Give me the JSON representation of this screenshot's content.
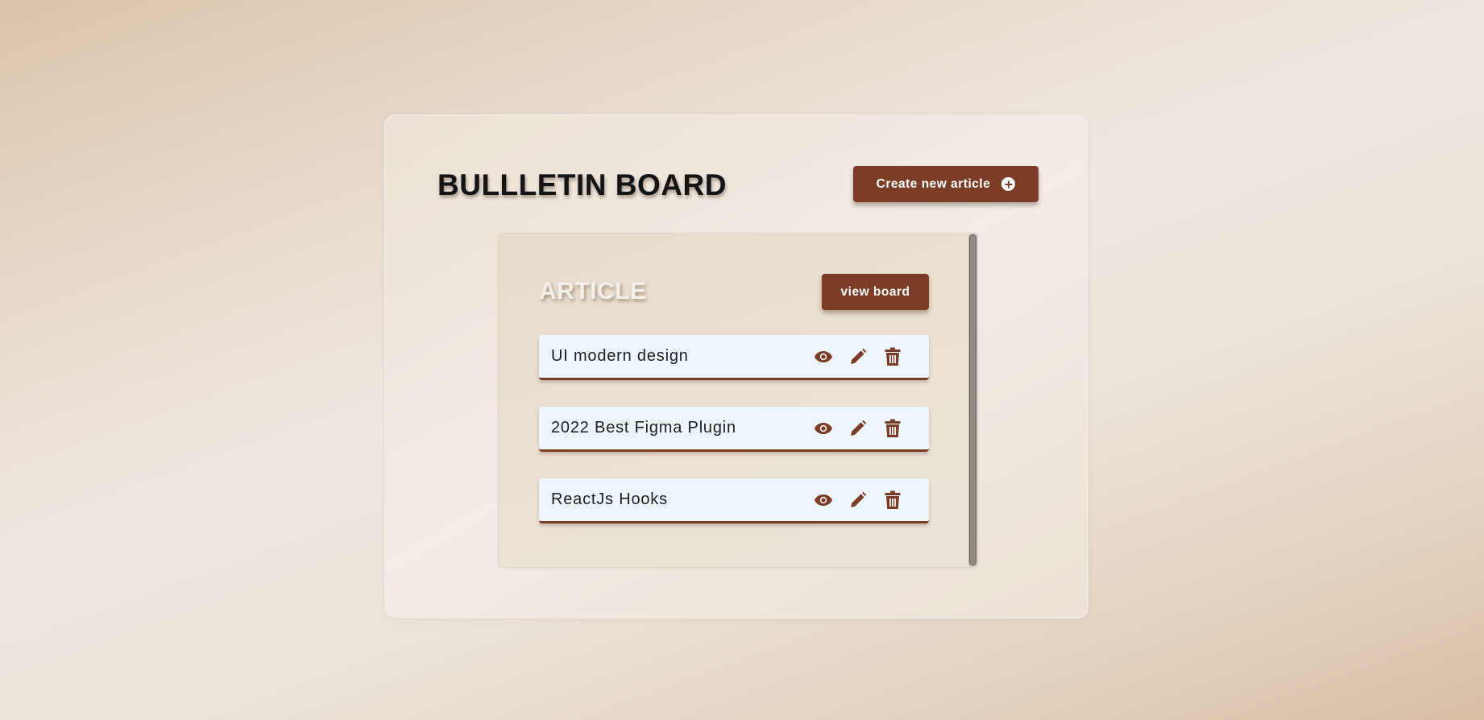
{
  "board": {
    "title": "BULLLETIN BOARD",
    "create_button_label": "Create new article",
    "create_button_icon": "plus-circle-icon"
  },
  "article_panel": {
    "title": "ARTICLE",
    "view_button_label": "view board",
    "items": [
      {
        "title": "UI modern design",
        "actions": [
          "eye-icon",
          "pencil-icon",
          "trash-icon"
        ]
      },
      {
        "title": "2022 Best Figma Plugin",
        "actions": [
          "eye-icon",
          "pencil-icon",
          "trash-icon"
        ]
      },
      {
        "title": "ReactJs Hooks",
        "actions": [
          "eye-icon",
          "pencil-icon",
          "trash-icon"
        ]
      }
    ]
  },
  "colors": {
    "accent": "#7b3d26",
    "row_background": "#edf6fd",
    "title_text": "#141414",
    "article_title_text": "#f3f0ec"
  }
}
